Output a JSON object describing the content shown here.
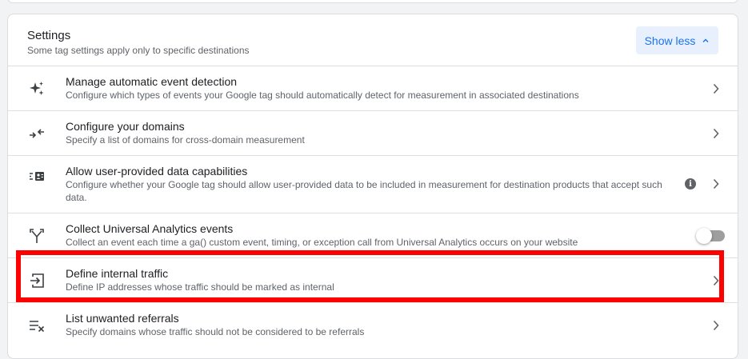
{
  "settings": {
    "title": "Settings",
    "subtitle": "Some tag settings apply only to specific destinations",
    "show_less_label": "Show less",
    "accent_color": "#1a73e8",
    "accent_bg": "#e8f0fe"
  },
  "rows": [
    {
      "icon": "auto-awesome-icon",
      "title": "Manage automatic event detection",
      "description": "Configure which types of events your Google tag should automatically detect for measurement in associated destinations",
      "trailing": "chevron-right-icon"
    },
    {
      "icon": "merge-arrows-icon",
      "title": "Configure your domains",
      "description": "Specify a list of domains for cross-domain measurement",
      "trailing": "chevron-right-icon"
    },
    {
      "icon": "user-data-icon",
      "title": "Allow user-provided data capabilities",
      "description": "Configure whether your Google tag should allow user-provided data to be included in measurement for destination products that accept such data.",
      "info": "i",
      "trailing": "chevron-right-icon"
    },
    {
      "icon": "call-split-icon",
      "title": "Collect Universal Analytics events",
      "description": "Collect an event each time a ga() custom event, timing, or exception call from Universal Analytics occurs on your website",
      "trailing": "toggle",
      "toggle_on": false
    },
    {
      "icon": "input-icon",
      "title": "Define internal traffic",
      "description": "Define IP addresses whose traffic should be marked as internal",
      "trailing": "chevron-right-icon",
      "highlighted": true,
      "highlight_color": "#ff0000"
    },
    {
      "icon": "playlist-remove-icon",
      "title": "List unwanted referrals",
      "description": "Specify domains whose traffic should not be considered to be referrals",
      "trailing": "chevron-right-icon"
    }
  ]
}
